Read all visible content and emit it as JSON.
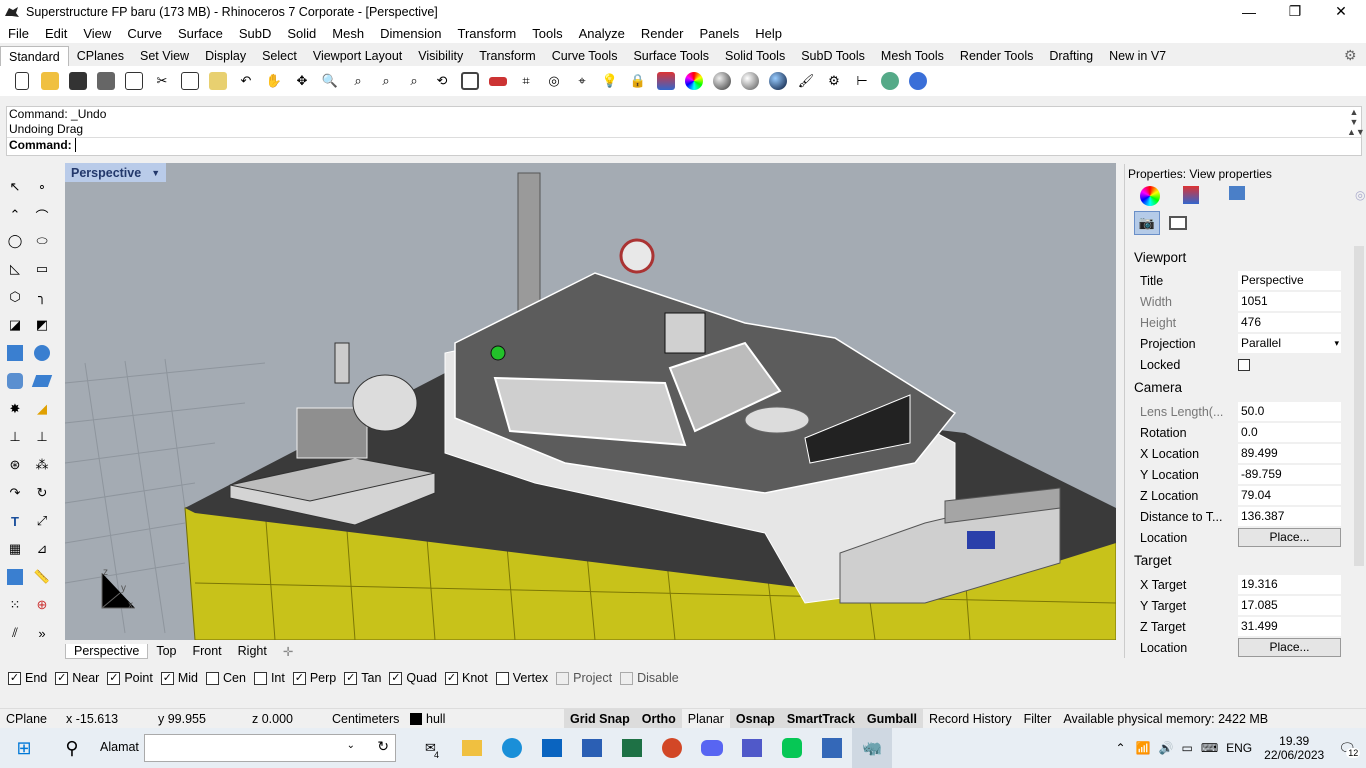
{
  "window": {
    "title": "Superstructure FP baru (173 MB) - Rhinoceros 7 Corporate - [Perspective]"
  },
  "menu": [
    "File",
    "Edit",
    "View",
    "Curve",
    "Surface",
    "SubD",
    "Solid",
    "Mesh",
    "Dimension",
    "Transform",
    "Tools",
    "Analyze",
    "Render",
    "Panels",
    "Help"
  ],
  "toolbar_tabs": [
    "Standard",
    "CPlanes",
    "Set View",
    "Display",
    "Select",
    "Viewport Layout",
    "Visibility",
    "Transform",
    "Curve Tools",
    "Surface Tools",
    "Solid Tools",
    "SubD Tools",
    "Mesh Tools",
    "Render Tools",
    "Drafting",
    "New in V7"
  ],
  "command": {
    "history": [
      "Command: _Undo",
      "Undoing Drag"
    ],
    "prompt": "Command:"
  },
  "viewport": {
    "active_label": "Perspective",
    "tabs": [
      "Perspective",
      "Top",
      "Front",
      "Right"
    ],
    "axis_labels": {
      "z": "z",
      "y": "y",
      "x": "x"
    }
  },
  "properties": {
    "title": "Properties: View properties",
    "viewport_section": "Viewport",
    "viewport": [
      {
        "key": "Title",
        "value": "Perspective"
      },
      {
        "key": "Width",
        "value": "1051"
      },
      {
        "key": "Height",
        "value": "476"
      },
      {
        "key": "Projection",
        "value": "Parallel"
      },
      {
        "key": "Locked",
        "value": ""
      }
    ],
    "camera_section": "Camera",
    "camera": [
      {
        "key": "Lens Length(...",
        "value": "50.0"
      },
      {
        "key": "Rotation",
        "value": "0.0"
      },
      {
        "key": "X Location",
        "value": "89.499"
      },
      {
        "key": "Y Location",
        "value": "-89.759"
      },
      {
        "key": "Z Location",
        "value": "79.04"
      },
      {
        "key": "Distance to T...",
        "value": "136.387"
      },
      {
        "key": "Location",
        "value": "Place..."
      }
    ],
    "target_section": "Target",
    "target": [
      {
        "key": "X Target",
        "value": "19.316"
      },
      {
        "key": "Y Target",
        "value": "17.085"
      },
      {
        "key": "Z Target",
        "value": "31.499"
      },
      {
        "key": "Location",
        "value": "Place..."
      }
    ]
  },
  "osnaps": [
    {
      "label": "End",
      "checked": true
    },
    {
      "label": "Near",
      "checked": true
    },
    {
      "label": "Point",
      "checked": true
    },
    {
      "label": "Mid",
      "checked": true
    },
    {
      "label": "Cen",
      "checked": false
    },
    {
      "label": "Int",
      "checked": false
    },
    {
      "label": "Perp",
      "checked": true
    },
    {
      "label": "Tan",
      "checked": true
    },
    {
      "label": "Quad",
      "checked": true
    },
    {
      "label": "Knot",
      "checked": true
    },
    {
      "label": "Vertex",
      "checked": false
    },
    {
      "label": "Project",
      "checked": false
    },
    {
      "label": "Disable",
      "checked": false
    }
  ],
  "status": {
    "cplane": "CPlane",
    "x": "x -15.613",
    "y": "y 99.955",
    "z": "z 0.000",
    "units": "Centimeters",
    "layer": "hull",
    "toggles": [
      {
        "label": "Grid Snap",
        "on": true
      },
      {
        "label": "Ortho",
        "on": true
      },
      {
        "label": "Planar",
        "on": false
      },
      {
        "label": "Osnap",
        "on": true
      },
      {
        "label": "SmartTrack",
        "on": true
      },
      {
        "label": "Gumball",
        "on": true
      },
      {
        "label": "Record History",
        "on": false
      },
      {
        "label": "Filter",
        "on": false
      }
    ],
    "memory": "Available physical memory: 2422 MB"
  },
  "taskbar": {
    "search_placeholder": "Alamat",
    "mail_badge": "4",
    "lang": "ENG",
    "time": "19.39",
    "date": "22/06/2023",
    "notif_count": "12"
  },
  "colors": {
    "hull": "#c8c21a",
    "viewport_bg": "#a4abb3",
    "deck": "#3a3a3a",
    "accent": "#0078d7"
  }
}
